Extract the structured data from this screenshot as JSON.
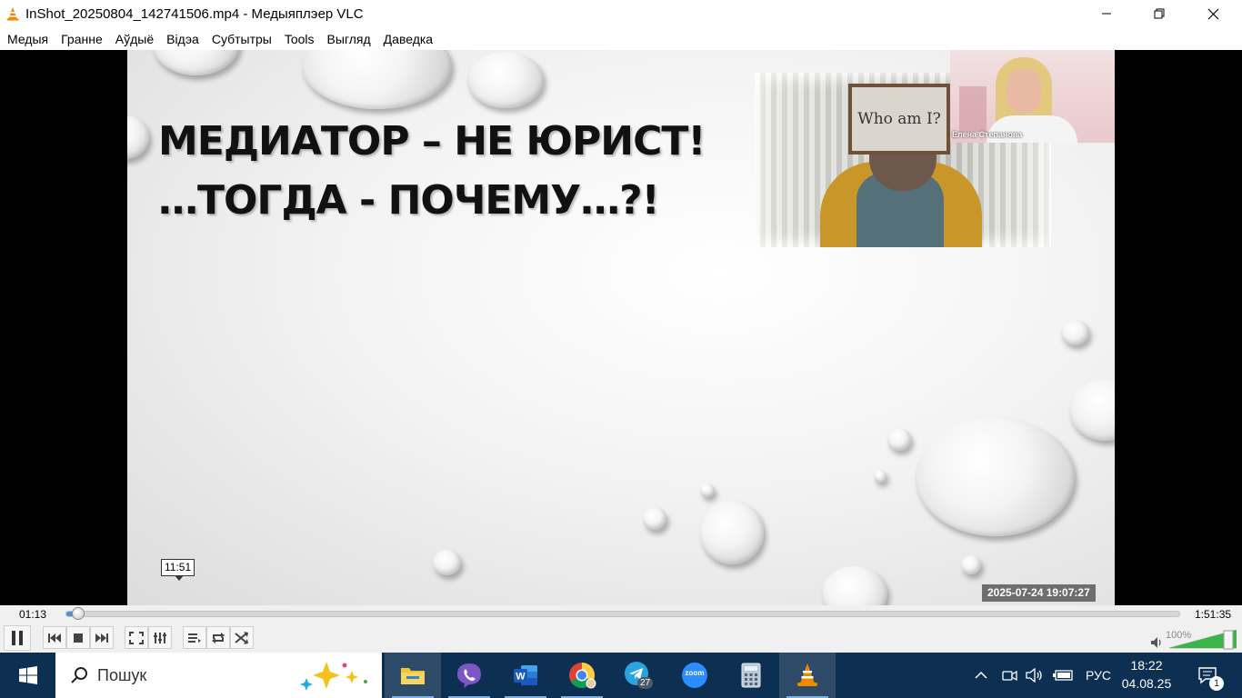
{
  "window": {
    "title": "InShot_20250804_142741506.mp4 - Медыяплэер VLC",
    "app_icon": "vlc-cone-icon"
  },
  "menu": [
    "Медыя",
    "Гранне",
    "Аўдыё",
    "Відэа",
    "Субтытры",
    "Tools",
    "Выгляд",
    "Даведка"
  ],
  "video": {
    "slide_title_line1": "МЕДИАТОР – НЕ ЮРИСТ!",
    "slide_title_line2": "…ТОГДА - ПОЧЕМУ…?!",
    "camera_sign_text": "Who am I?",
    "participant_name": "Елена Степанова",
    "time_tooltip": "11:51",
    "recording_timestamp": "2025-07-24  19:07:27"
  },
  "seek": {
    "elapsed": "01:13",
    "total": "1:51:35",
    "progress_fraction": 0.011
  },
  "controls": {
    "icons": [
      "pause-icon",
      "previous-icon",
      "stop-icon",
      "next-icon",
      "fullscreen-icon",
      "extended-settings-icon",
      "playlist-icon",
      "loop-icon",
      "shuffle-icon",
      "volume-icon"
    ],
    "volume_label": "100%",
    "volume_fraction": 1.0
  },
  "taskbar": {
    "search_placeholder": "Пошук",
    "apps": [
      "file-explorer-icon",
      "viber-icon",
      "word-icon",
      "chrome-icon",
      "telegram-icon",
      "zoom-icon",
      "calculator-icon",
      "vlc-icon"
    ],
    "telegram_badge": "27",
    "zoom_label": "zoom",
    "language": "РУС",
    "time": "18:22",
    "date": "04.08.25",
    "notification_count": "1"
  },
  "colors": {
    "taskbar": "#0c2f52",
    "seek_fill": "#4a90d9",
    "volume_green": "#3bb54a",
    "vlc_orange": "#f08a00"
  }
}
